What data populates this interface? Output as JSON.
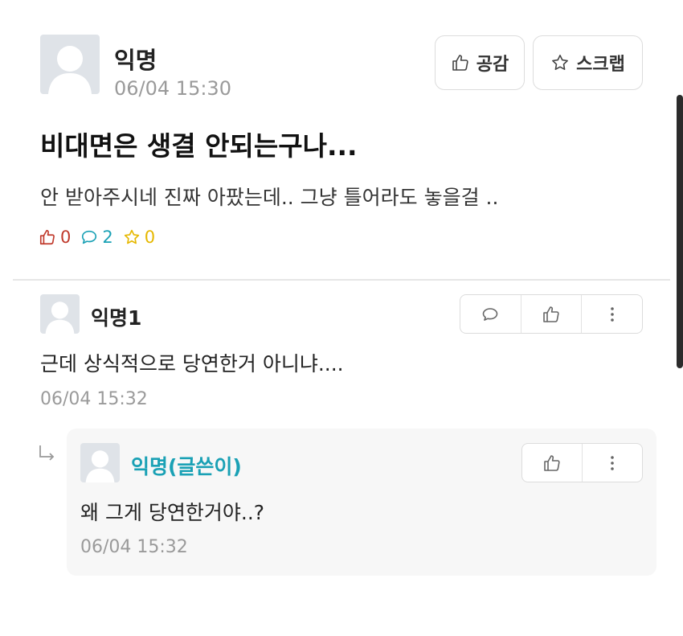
{
  "post": {
    "author": "익명",
    "time": "06/04 15:30",
    "title": "비대면은 생결 안되는구나...",
    "body": "안 받아주시네 진짜 아팠는데.. 그냥 틀어라도 놓을걸 ..",
    "like_button_label": "공감",
    "scrap_button_label": "스크랩",
    "stats": {
      "likes": "0",
      "comments": "2",
      "scraps": "0"
    }
  },
  "comment": {
    "author": "익명1",
    "body": "근데 상식적으로 당연한거 아니냐....",
    "time": "06/04 15:32"
  },
  "reply": {
    "author": "익명(글쓴이)",
    "body": "왜 그게 당연한거야..?",
    "time": "06/04 15:32"
  },
  "colors": {
    "like": "#c0392b",
    "comment": "#1aa1b5",
    "scrap": "#e6b800",
    "writer": "#1aa1b5",
    "timestamp": "#9a9a9a",
    "avatar_bg": "#dfe3e8"
  },
  "icons": {
    "avatar": "person-silhouette-icon",
    "like": "thumbs-up-icon",
    "comment": "speech-bubble-icon",
    "scrap": "star-icon",
    "more": "more-vertical-icon",
    "reply_marker": "reply-arrow-icon"
  }
}
